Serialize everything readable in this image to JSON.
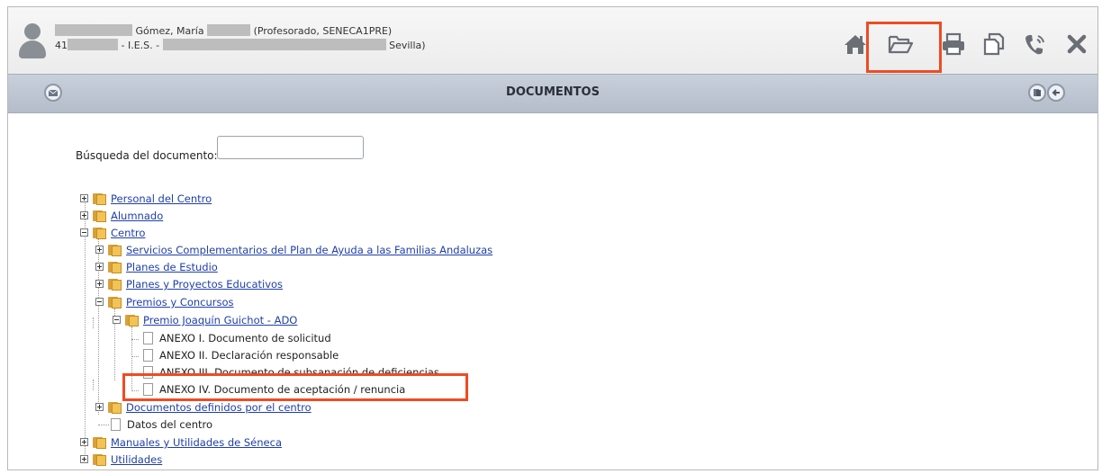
{
  "header": {
    "user_name": "Gómez, María",
    "user_role": "(Profesorado, SENECA1PRE)",
    "code_prefix": "41",
    "school": "- I.E.S. -",
    "city": "Sevilla)"
  },
  "toolbar": {
    "icons": [
      "home-icon",
      "folder-open-icon",
      "print-icon",
      "copy-icon",
      "phone-icon",
      "close-icon"
    ]
  },
  "titlebar": {
    "title": "DOCUMENTOS"
  },
  "search": {
    "label": "Búsqueda del documento:",
    "value": "",
    "placeholder": ""
  },
  "tree": {
    "personal": "Personal del Centro",
    "alumnado": "Alumnado",
    "centro": "Centro",
    "servicios": "Servicios Complementarios del Plan de Ayuda a las Familias Andaluzas",
    "planes_estudio": "Planes de Estudio",
    "planes_proyectos": "Planes y Proyectos Educativos",
    "premios": "Premios y Concursos",
    "premio_guichot": "Premio Joaquín Guichot - ADO",
    "anexo1": "ANEXO I. Documento de solicitud",
    "anexo2": "ANEXO II. Declaración responsable",
    "anexo3": "ANEXO III. Documento de subsanación de deficiencias",
    "anexo4": "ANEXO IV. Documento de aceptación / renuncia",
    "documentos_definidos": "Documentos definidos por el centro",
    "datos_centro": "Datos del centro",
    "manuales": "Manuales y Utilidades de Séneca",
    "utilidades": "Utilidades"
  },
  "colors": {
    "highlight": "#ef4b23",
    "link": "#1f3fa8",
    "titlebar": "#bcc5d1"
  }
}
